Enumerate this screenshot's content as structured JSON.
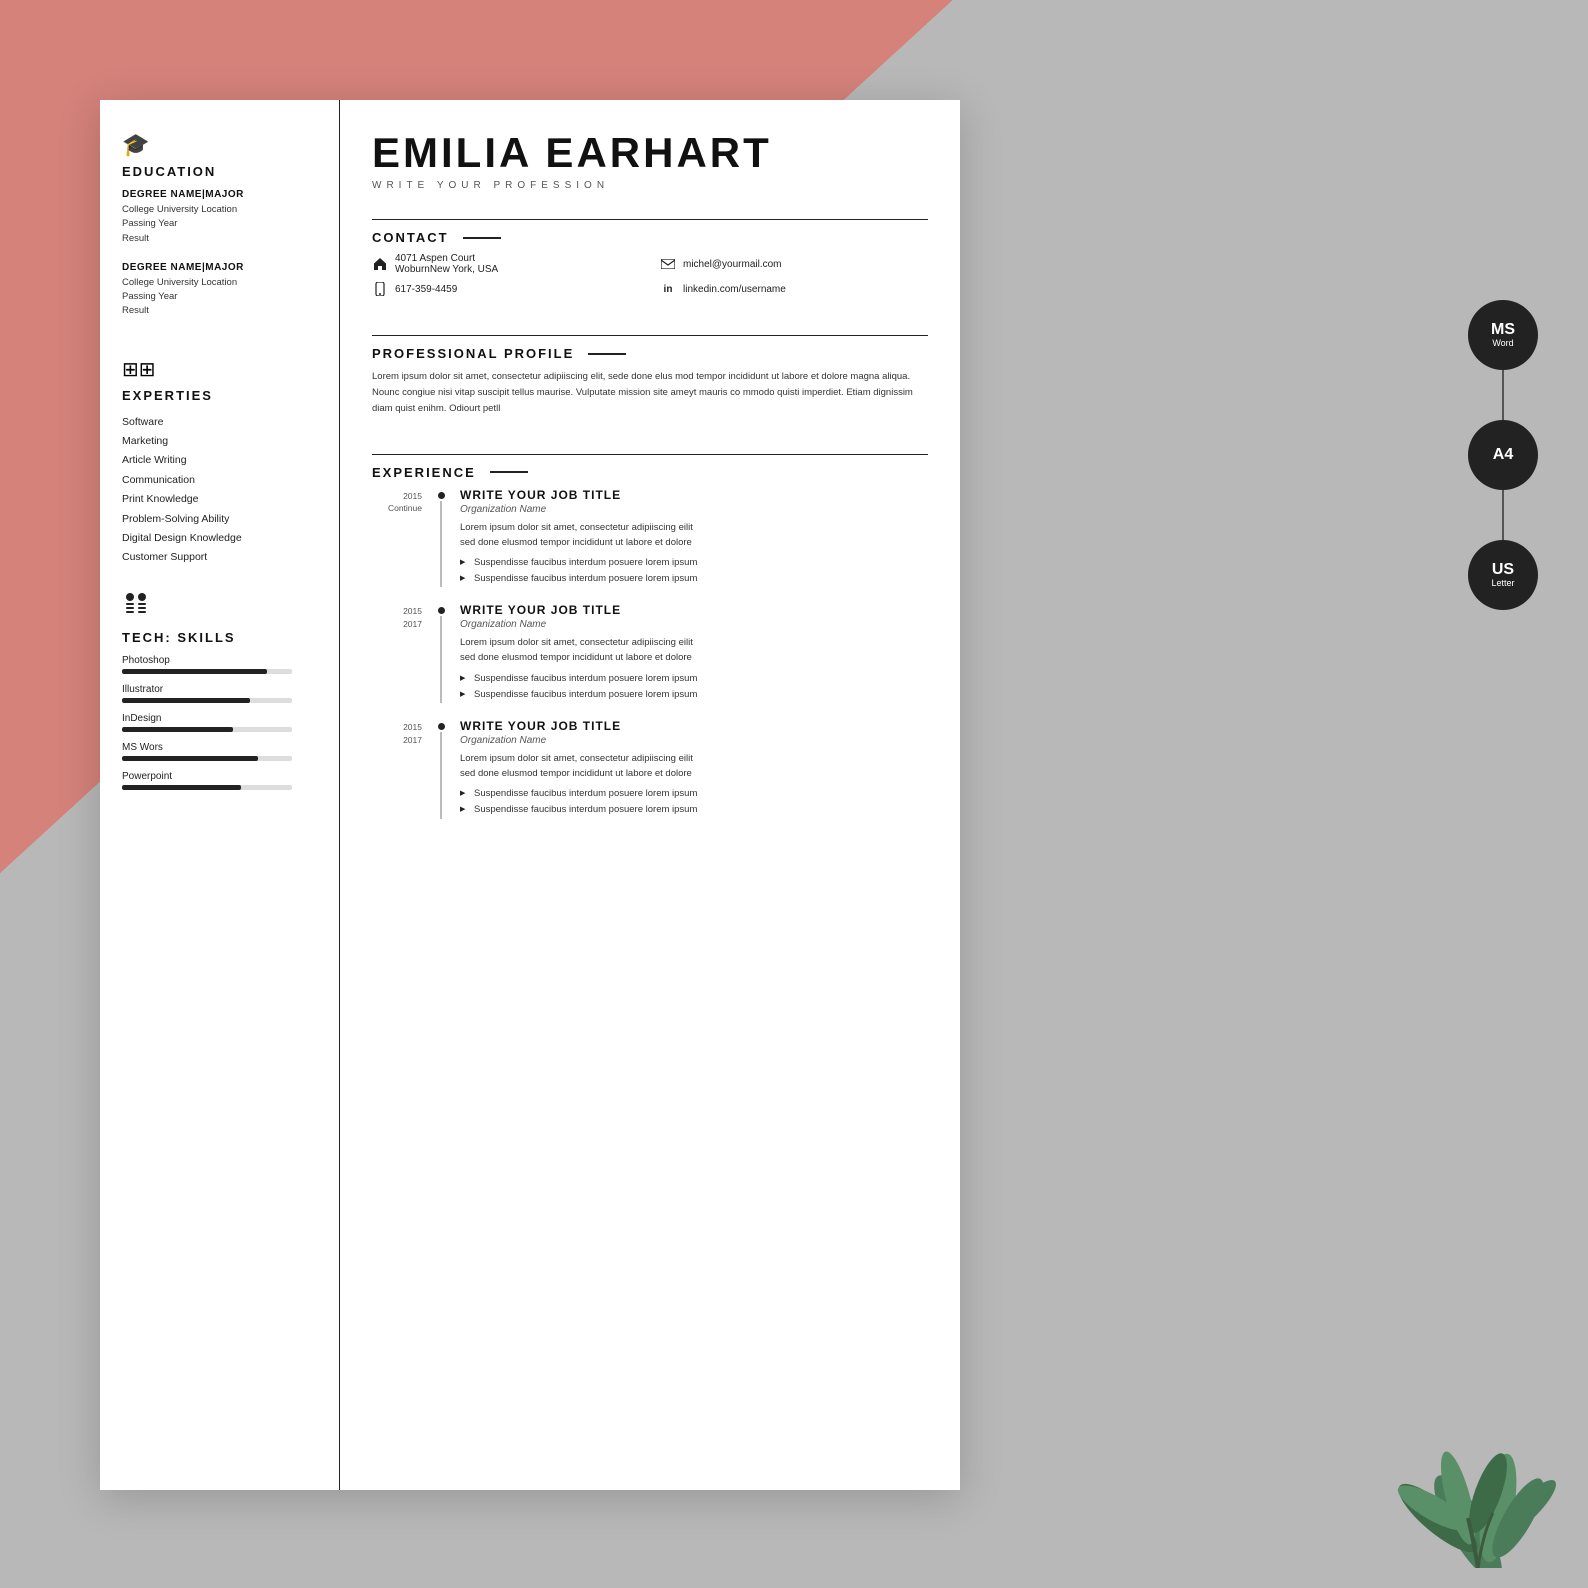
{
  "background": {
    "pink_label": "pink background",
    "gray_label": "gray background"
  },
  "resume": {
    "sidebar": {
      "education": {
        "icon": "🎓",
        "title": "Education",
        "entries": [
          {
            "degree": "DEGREE NAME|MAJOR",
            "lines": [
              "College University Location",
              "Passing Year",
              "Result"
            ]
          },
          {
            "degree": "DEGREE NAME|MAJOR",
            "lines": [
              "College University Location",
              "Passing Year",
              "Result"
            ]
          }
        ]
      },
      "experties": {
        "icon": "⊞",
        "title": "Experties",
        "items": [
          "Software",
          "Marketing",
          "Article Writing",
          "Communication",
          "Print Knowledge",
          "Problem-Solving Ability",
          "Digital Design Knowledge",
          "Customer Support"
        ]
      },
      "tech_skills": {
        "icon": "👤",
        "title": "Tech: Skills",
        "skills": [
          {
            "name": "Photoshop",
            "percent": 85
          },
          {
            "name": "Illustrator",
            "percent": 75
          },
          {
            "name": "InDesign",
            "percent": 65
          },
          {
            "name": "MS Wors",
            "percent": 80
          },
          {
            "name": "Powerpoint",
            "percent": 70
          }
        ]
      }
    },
    "main": {
      "name": "EMILIA EARHART",
      "profession": "WRITE YOUR PROFESSION",
      "contact": {
        "title": "CONTACT",
        "items": [
          {
            "icon": "🏠",
            "text": "4071 Aspen Court\nWoburnNew York, USA"
          },
          {
            "icon": "✉",
            "text": "michel@yourmail.com"
          },
          {
            "icon": "📱",
            "text": "617-359-4459"
          },
          {
            "icon": "in",
            "text": "linkedin.com/username"
          }
        ]
      },
      "profile": {
        "title": "PROFESSIONAL PROFILE",
        "text": "Lorem ipsum dolor sit amet, consectetur adipiiscing elit, sede done elus mod tempor incididunt ut labore et dolore magna aliqua. Nounc congiue nisi vitap suscipit tellus maurise. Vulputate mission site ameyt mauris co mmodo quisti imperdiet. Etiam dignissim diam quist enihm. Odiourt petll"
      },
      "experience": {
        "title": "EXPERIENCE",
        "entries": [
          {
            "year_start": "2015",
            "year_end": "Continue",
            "job_title": "WRITE YOUR JOB TITLE",
            "org": "Organization Name",
            "desc": "Lorem ipsum dolor sit amet, consectetur adipiiscing eilit\nsed done elusmod tempor incididunt ut labore et dolore",
            "bullets": [
              "Suspendisse faucibus interdum posuere lorem ipsum",
              "Suspendisse faucibus interdum posuere lorem ipsum"
            ]
          },
          {
            "year_start": "2015",
            "year_end": "2017",
            "job_title": "WRITE YOUR JOB TITLE",
            "org": "Organization Name",
            "desc": "Lorem ipsum dolor sit amet, consectetur adipiiscing eilit\nsed done elusmod tempor incididunt ut labore et dolore",
            "bullets": [
              "Suspendisse faucibus interdum posuere lorem ipsum",
              "Suspendisse faucibus interdum posuere lorem ipsum"
            ]
          },
          {
            "year_start": "2015",
            "year_end": "2017",
            "job_title": "WRITE YOUR JOB TITLE",
            "org": "Organization Name",
            "desc": "Lorem ipsum dolor sit amet, consectetur adipiiscing eilit\nsed done elusmod tempor incididunt ut labore et dolore",
            "bullets": [
              "Suspendisse faucibus interdum posuere lorem ipsum",
              "Suspendisse faucibus interdum posuere lorem ipsum"
            ]
          }
        ]
      }
    }
  },
  "badges": [
    {
      "main": "MS",
      "sub": "Word"
    },
    {
      "main": "A4",
      "sub": ""
    },
    {
      "main": "US",
      "sub": "Letter"
    }
  ]
}
